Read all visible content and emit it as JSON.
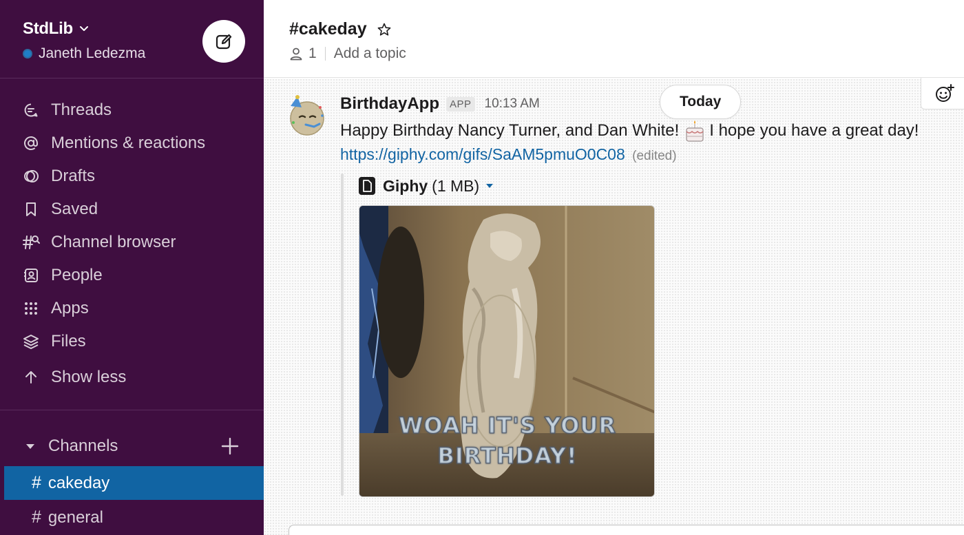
{
  "workspace": {
    "name": "StdLib",
    "user": "Janeth Ledezma"
  },
  "sidebar": {
    "nav": [
      {
        "label": "Threads",
        "icon": "threads-icon"
      },
      {
        "label": "Mentions & reactions",
        "icon": "at-icon"
      },
      {
        "label": "Drafts",
        "icon": "drafts-icon"
      },
      {
        "label": "Saved",
        "icon": "bookmark-icon"
      },
      {
        "label": "Channel browser",
        "icon": "channel-browser-icon"
      },
      {
        "label": "People",
        "icon": "people-icon"
      },
      {
        "label": "Apps",
        "icon": "apps-icon"
      },
      {
        "label": "Files",
        "icon": "files-icon"
      },
      {
        "label": "Show less",
        "icon": "arrow-up-icon"
      }
    ],
    "channels_label": "Channels",
    "channels": [
      {
        "hash": "#",
        "name": "cakeday",
        "active": true
      },
      {
        "hash": "#",
        "name": "general",
        "active": false
      }
    ]
  },
  "channel": {
    "title": "#cakeday",
    "member_count": "1",
    "topic_placeholder": "Add a topic"
  },
  "feed": {
    "day_divider": "Today",
    "message": {
      "sender": "BirthdayApp",
      "badge": "APP",
      "time": "10:13 AM",
      "text_before_emoji": "Happy Birthday Nancy Turner, and Dan White!",
      "text_after_emoji": "I hope you have a great day!",
      "link": "https://giphy.com/gifs/SaAM5pmuO0C08",
      "edited": "(edited)",
      "attachment": {
        "title": "Giphy",
        "size": "(1 MB)",
        "caption_line1": "WOAH IT'S YOUR",
        "caption_line2": "BIRTHDAY!"
      }
    }
  },
  "colors": {
    "sidebar_bg": "#3f0e40",
    "active_channel": "#1164a3",
    "link": "#1264a3",
    "presence": "#1f7ec7"
  }
}
